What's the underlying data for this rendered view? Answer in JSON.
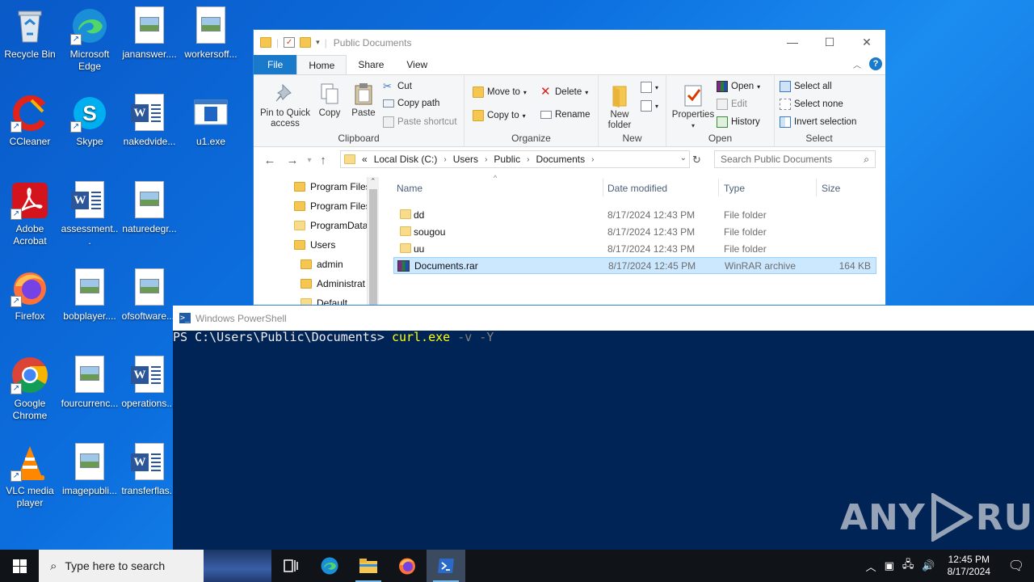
{
  "desktop": {
    "icons": [
      {
        "label": "Recycle Bin"
      },
      {
        "label": "Microsoft Edge"
      },
      {
        "label": "jananswer...."
      },
      {
        "label": "workersoff..."
      },
      {
        "label": "CCleaner"
      },
      {
        "label": "Skype"
      },
      {
        "label": "nakedvide..."
      },
      {
        "label": "u1.exe"
      },
      {
        "label": "Adobe Acrobat"
      },
      {
        "label": "assessment..."
      },
      {
        "label": "naturedegr..."
      },
      {
        "label": "Firefox"
      },
      {
        "label": "bobplayer...."
      },
      {
        "label": "ofsoftware...."
      },
      {
        "label": "Google Chrome"
      },
      {
        "label": "fourcurrenc..."
      },
      {
        "label": "operations...."
      },
      {
        "label": "VLC media player"
      },
      {
        "label": "imagepubli..."
      },
      {
        "label": "transferflas..."
      }
    ]
  },
  "explorer": {
    "title": "Public Documents",
    "tabs": [
      "File",
      "Home",
      "Share",
      "View"
    ],
    "clipboard": {
      "pin": "Pin to Quick access",
      "copy": "Copy",
      "paste": "Paste",
      "cut": "Cut",
      "copy_path": "Copy path",
      "paste_shortcut": "Paste shortcut",
      "group": "Clipboard"
    },
    "organize": {
      "move_to": "Move to",
      "copy_to": "Copy to",
      "delete": "Delete",
      "rename": "Rename",
      "group": "Organize"
    },
    "new": {
      "new_folder": "New folder",
      "group": "New"
    },
    "open": {
      "properties": "Properties",
      "open": "Open",
      "edit": "Edit",
      "history": "History",
      "group": "Open"
    },
    "select": {
      "select_all": "Select all",
      "select_none": "Select none",
      "invert": "Invert selection",
      "group": "Select"
    },
    "address": {
      "prefix": "«",
      "crumbs": [
        "Local Disk (C:)",
        "Users",
        "Public",
        "Documents"
      ]
    },
    "search_placeholder": "Search Public Documents",
    "nav_items": [
      "Program Files",
      "Program Files",
      "ProgramData",
      "Users",
      "admin",
      "Administrat",
      "Default"
    ],
    "columns": [
      "Name",
      "Date modified",
      "Type",
      "Size"
    ],
    "files": [
      {
        "name": "dd",
        "date": "8/17/2024 12:43 PM",
        "type": "File folder",
        "size": ""
      },
      {
        "name": "sougou",
        "date": "8/17/2024 12:43 PM",
        "type": "File folder",
        "size": ""
      },
      {
        "name": "uu",
        "date": "8/17/2024 12:43 PM",
        "type": "File folder",
        "size": ""
      },
      {
        "name": "Documents.rar",
        "date": "8/17/2024 12:45 PM",
        "type": "WinRAR archive",
        "size": "164 KB"
      }
    ]
  },
  "powershell": {
    "title": "Windows PowerShell",
    "prompt": "PS C:\\Users\\Public\\Documents> ",
    "command": "curl.exe",
    "args": " -v -Y"
  },
  "watermark": {
    "left": "ANY",
    "right": "RUN"
  },
  "taskbar": {
    "search_placeholder": "Type here to search",
    "time": "12:45 PM",
    "date": "8/17/2024"
  },
  "colors": {
    "accent": "#1979ca",
    "ps_bg": "#012456",
    "selection": "#cce8ff"
  }
}
